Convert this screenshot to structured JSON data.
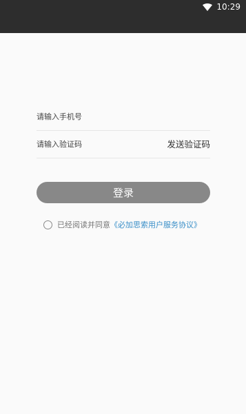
{
  "status_bar": {
    "time": "10:29",
    "wifi_icon": "wifi-icon"
  },
  "login_form": {
    "phone_placeholder": "请输入手机号",
    "code_placeholder": "请输入验证码",
    "send_code_label": "发送验证码",
    "login_label": "登录",
    "agreement_prefix": "已经阅读并同意",
    "agreement_link": "《必加思索用户服务协议》"
  },
  "colors": {
    "status_bar_bg": "#2d2d2d",
    "login_button_bg": "#888888",
    "link": "#3a8fc8",
    "page_bg": "#fafafa"
  }
}
